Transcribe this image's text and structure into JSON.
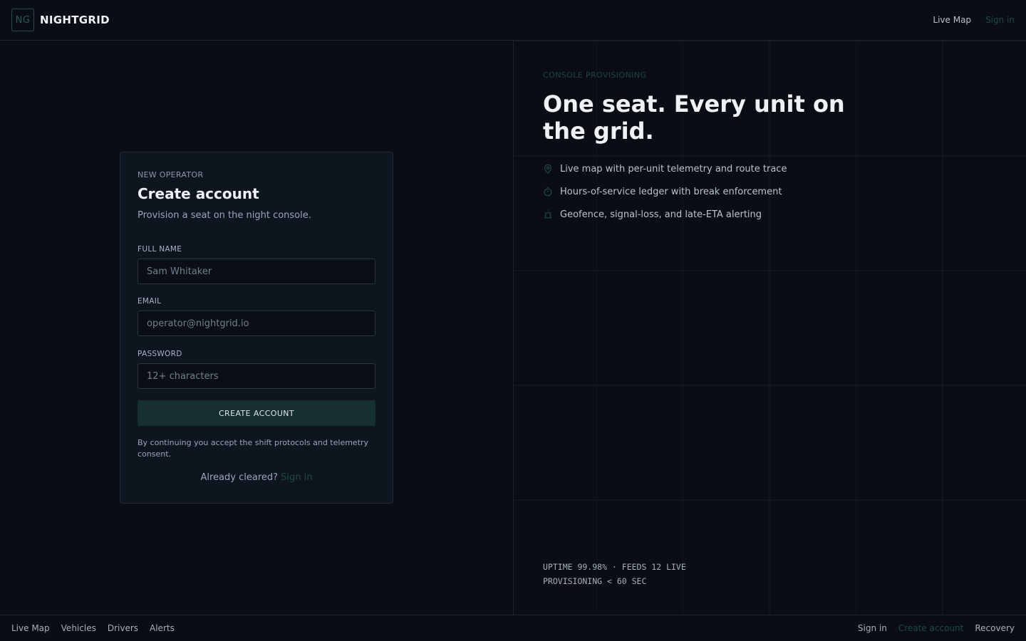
{
  "topbar": {
    "logo_text": "NG",
    "brand_name": "NIGHTGRID",
    "nav": [
      {
        "label": "Live Map"
      },
      {
        "label": "Sign in"
      }
    ]
  },
  "form": {
    "eyebrow": "NEW OPERATOR",
    "title": "Create account",
    "subtitle": "Provision a seat on the night console.",
    "fields": {
      "name": {
        "label": "FULL NAME",
        "placeholder": "Sam Whitaker",
        "value": ""
      },
      "email": {
        "label": "EMAIL",
        "placeholder": "operator@nightgrid.io",
        "value": ""
      },
      "password": {
        "label": "PASSWORD",
        "placeholder": "12+ characters",
        "value": ""
      }
    },
    "submit_label": "CREATE ACCOUNT",
    "consent": "By continuing you accept the shift protocols and telemetry consent.",
    "signin_prompt": "Already cleared?",
    "signin_link": "Sign in"
  },
  "hero": {
    "kicker": "CONSOLE PROVISIONING",
    "headline": "One seat. Every unit on the grid.",
    "features": [
      {
        "icon": "map-pin-icon",
        "text": "Live map with per-unit telemetry and route trace"
      },
      {
        "icon": "timer-icon",
        "text": "Hours-of-service ledger with break enforcement"
      },
      {
        "icon": "alarm-icon",
        "text": "Geofence, signal-loss, and late-ETA alerting"
      }
    ],
    "stats": [
      "UPTIME 99.98% · FEEDS 12 LIVE",
      "PROVISIONING < 60 SEC"
    ]
  },
  "footer": {
    "left": [
      {
        "label": "Live Map"
      },
      {
        "label": "Vehicles"
      },
      {
        "label": "Drivers"
      },
      {
        "label": "Alerts"
      }
    ],
    "right": [
      {
        "label": "Sign in"
      },
      {
        "label": "Create account"
      },
      {
        "label": "Recovery"
      }
    ]
  },
  "colors": {
    "background": "#0a0e14",
    "card": "#0e151f",
    "accent_teal": "#1f4847",
    "button": "#15302f",
    "grid_line": "#151c26"
  }
}
